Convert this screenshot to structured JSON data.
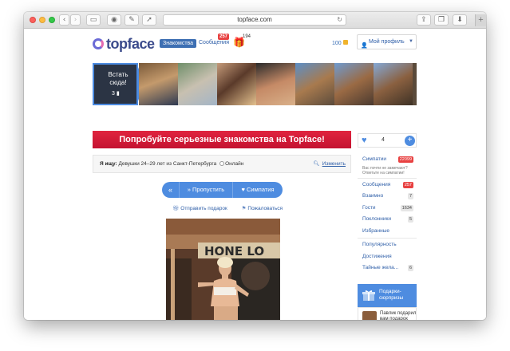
{
  "browser": {
    "url": "topface.com",
    "buttons": [
      "back",
      "forward",
      "sidebar",
      "pinterest",
      "share-extension",
      "reader"
    ]
  },
  "header": {
    "logo_text": "topface",
    "nav_active": "Знакомства",
    "nav_messages": "Сообщения",
    "messages_badge": "257",
    "gifts_count": "194",
    "coins": "100",
    "profile_label": "Мой профиль"
  },
  "strip": {
    "first_tile_text": "Встать сюда!",
    "first_tile_count": "3"
  },
  "banner": {
    "text": "Попробуйте серьезные знакомства на Topface!"
  },
  "search": {
    "label": "Я ищу:",
    "criteria": "Девушки  24–29 лет из Санкт-Петербурга",
    "online_label": "Онлайн",
    "change_label": "Изменить"
  },
  "actions": {
    "back_label": "«",
    "skip_label": "» Пропустить",
    "like_label": "Симпатия",
    "gift_label": "Отправить подарок",
    "report_label": "Пожаловаться"
  },
  "sidebar": {
    "likes_count": "4",
    "menu": [
      {
        "label": "Симпатии",
        "count": "22099",
        "red": true
      },
      {
        "label": "Сообщения",
        "count": "257",
        "red": true
      },
      {
        "label": "Взаимно",
        "count": "7",
        "red": false
      },
      {
        "label": "Гости",
        "count": "1634",
        "red": false
      },
      {
        "label": "Поклонники",
        "count": "5",
        "red": false
      },
      {
        "label": "Избранные",
        "count": "",
        "red": false
      },
      {
        "label": "Популярность",
        "count": "",
        "red": false
      },
      {
        "label": "Достижения",
        "count": "",
        "red": false
      },
      {
        "label": "Тайные жела...",
        "count": "6",
        "red": false
      }
    ],
    "likes_note": "Вас почти не замечают? Ответьте на симпатии!",
    "gifts_header": "Подарки-сюрпризы",
    "gift_feed_text": "Павлик подарил вам подарок"
  },
  "colors": {
    "accent": "#4e8ce0",
    "brand": "#3b4b8c",
    "banner": "#d31a37",
    "badge": "#e84141"
  }
}
